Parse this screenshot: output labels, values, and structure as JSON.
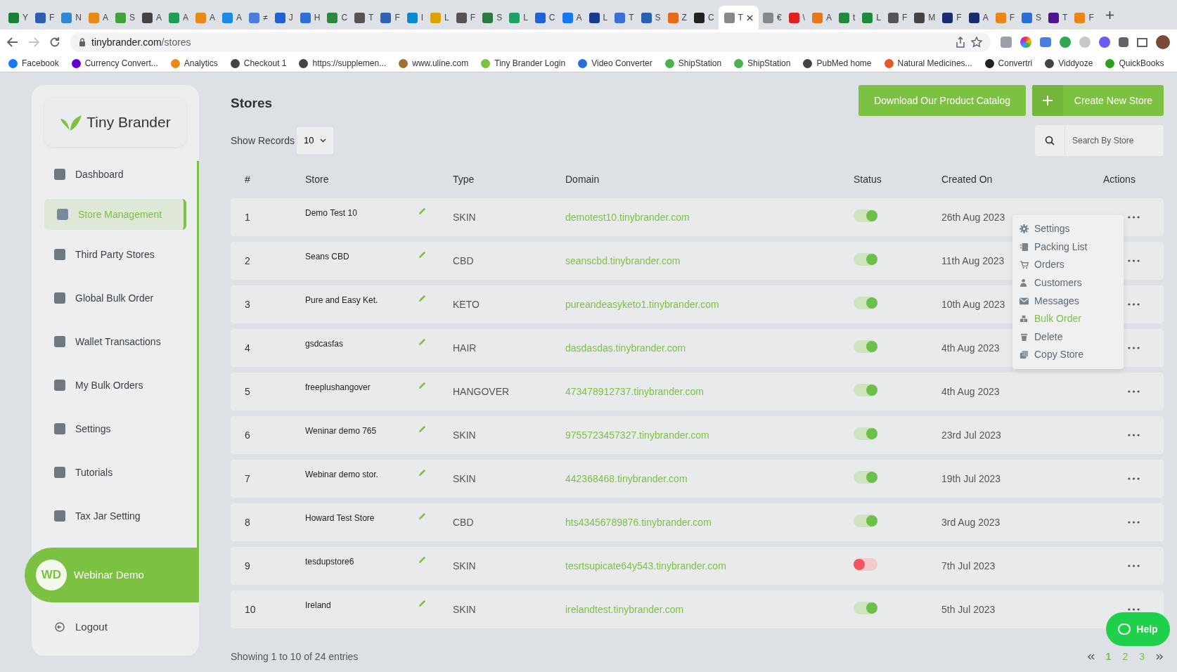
{
  "browser": {
    "tabs": [
      {
        "title": "Y",
        "selected": false
      },
      {
        "title": "F",
        "selected": false
      },
      {
        "title": "N",
        "selected": false
      },
      {
        "title": "A",
        "selected": false
      },
      {
        "title": "S",
        "selected": false
      },
      {
        "title": "A",
        "selected": false
      },
      {
        "title": "A",
        "selected": false
      },
      {
        "title": "A",
        "selected": false
      },
      {
        "title": "A",
        "selected": false
      },
      {
        "title": "≠",
        "selected": false
      },
      {
        "title": "J",
        "selected": false
      },
      {
        "title": "H",
        "selected": false
      },
      {
        "title": "C",
        "selected": false
      },
      {
        "title": "T",
        "selected": false
      },
      {
        "title": "F",
        "selected": false
      },
      {
        "title": "I",
        "selected": false
      },
      {
        "title": "L",
        "selected": false
      },
      {
        "title": "F",
        "selected": false
      },
      {
        "title": "S",
        "selected": false
      },
      {
        "title": "L",
        "selected": false
      },
      {
        "title": "C",
        "selected": false
      },
      {
        "title": "A",
        "selected": false
      },
      {
        "title": "L",
        "selected": false
      },
      {
        "title": "T",
        "selected": false
      },
      {
        "title": "S",
        "selected": false
      },
      {
        "title": "Z",
        "selected": false
      },
      {
        "title": "C",
        "selected": false
      },
      {
        "title": "T",
        "selected": true
      },
      {
        "title": "€",
        "selected": false
      },
      {
        "title": "\\",
        "selected": false
      },
      {
        "title": "A",
        "selected": false
      },
      {
        "title": "t",
        "selected": false
      },
      {
        "title": "L",
        "selected": false
      },
      {
        "title": "F",
        "selected": false
      },
      {
        "title": "M",
        "selected": false
      },
      {
        "title": "F",
        "selected": false
      },
      {
        "title": "A",
        "selected": false
      },
      {
        "title": "F",
        "selected": false
      },
      {
        "title": "S",
        "selected": false
      },
      {
        "title": "T",
        "selected": false
      },
      {
        "title": "F",
        "selected": false
      }
    ],
    "url_host": "tinybrander.com",
    "url_path": "/stores",
    "bookmarks": [
      "Facebook",
      "Currency Convert...",
      "Analytics",
      "Checkout 1",
      "https://supplemen...",
      "www.uline.com",
      "Tiny Brander Login",
      "Video Converter",
      "ShipStation",
      "ShipStation",
      "PubMed home",
      "Natural Medicines...",
      "Convertri",
      "Viddyoze",
      "QuickBooks"
    ]
  },
  "sidebar": {
    "logo": "Tiny Brander",
    "items": [
      {
        "label": "Dashboard",
        "selected": false
      },
      {
        "label": "Store Management",
        "selected": true
      },
      {
        "label": "Third Party Stores",
        "selected": false
      },
      {
        "label": "Global Bulk Order",
        "selected": false
      },
      {
        "label": "Wallet Transactions",
        "selected": false
      },
      {
        "label": "My Bulk Orders",
        "selected": false
      },
      {
        "label": "Settings",
        "selected": false
      },
      {
        "label": "Tutorials",
        "selected": false
      },
      {
        "label": "Tax Jar Setting",
        "selected": false
      }
    ],
    "user": {
      "initials": "WD",
      "name": "Webinar Demo"
    },
    "logout": "Logout"
  },
  "page": {
    "title": "Stores",
    "buttons": [
      "Download Our Product Catalog",
      "Create New Store"
    ],
    "show_records_label": "Show Records",
    "show_records_value": "10",
    "search_placeholder": "Search By Store"
  },
  "table": {
    "columns": [
      "#",
      "Store",
      "Type",
      "Domain",
      "Status",
      "Created On",
      "Actions"
    ],
    "rows": [
      {
        "num": "1",
        "store": "Demo Test 10",
        "type": "SKIN",
        "domain": "demotest10.tinybrander.com",
        "on": true,
        "created": "26th Aug 2023"
      },
      {
        "num": "2",
        "store": "Seans CBD",
        "type": "CBD",
        "domain": "seanscbd.tinybrander.com",
        "on": true,
        "created": "11th Aug 2023"
      },
      {
        "num": "3",
        "store": "Pure and Easy Ket.",
        "type": "KETO",
        "domain": "pureandeasyketo1.tinybrander.com",
        "on": true,
        "created": "10th Aug 2023"
      },
      {
        "num": "4",
        "store": "gsdcasfas",
        "type": "HAIR",
        "domain": "dasdasdas.tinybrander.com",
        "on": true,
        "created": "4th Aug 2023"
      },
      {
        "num": "5",
        "store": "freeplushangover",
        "type": "HANGOVER",
        "domain": "473478912737.tinybrander.com",
        "on": true,
        "created": "4th Aug 2023"
      },
      {
        "num": "6",
        "store": "Weninar demo 765",
        "type": "SKIN",
        "domain": "9755723457327.tinybrander.com",
        "on": true,
        "created": "23rd Jul 2023"
      },
      {
        "num": "7",
        "store": "Webinar demo stor.",
        "type": "SKIN",
        "domain": "442368468.tinybrander.com",
        "on": true,
        "created": "19th Jul 2023"
      },
      {
        "num": "8",
        "store": "Howard Test Store",
        "type": "CBD",
        "domain": "hts43456789876.tinybrander.com",
        "on": true,
        "created": "3rd Aug 2023"
      },
      {
        "num": "9",
        "store": "tesdupstore6",
        "type": "SKIN",
        "domain": "tesrtsupicate64y543.tinybrander.com",
        "on": false,
        "created": "7th Jul 2023"
      },
      {
        "num": "10",
        "store": "Ireland",
        "type": "SKIN",
        "domain": "irelandtest.tinybrander.com",
        "on": true,
        "created": "5th Jul 2023"
      }
    ]
  },
  "actions_menu": {
    "items": [
      {
        "label": "Settings",
        "kind": "gear",
        "hovered": false
      },
      {
        "label": "Packing List",
        "kind": "list",
        "hovered": false
      },
      {
        "label": "Orders",
        "kind": "cart",
        "hovered": false
      },
      {
        "label": "Customers",
        "kind": "person",
        "hovered": false
      },
      {
        "label": "Messages",
        "kind": "mail",
        "hovered": false
      },
      {
        "label": "Bulk Order",
        "kind": "boxes",
        "hovered": true
      },
      {
        "label": "Delete",
        "kind": "trash",
        "hovered": false
      },
      {
        "label": "Copy Store",
        "kind": "copy",
        "hovered": false
      }
    ]
  },
  "footer": {
    "summary": "Showing 1 to 10 of 24 entries",
    "pages": [
      {
        "label": "1",
        "selected": true
      },
      {
        "label": "2",
        "selected": false
      },
      {
        "label": "3",
        "selected": false
      }
    ]
  },
  "help": "Help"
}
